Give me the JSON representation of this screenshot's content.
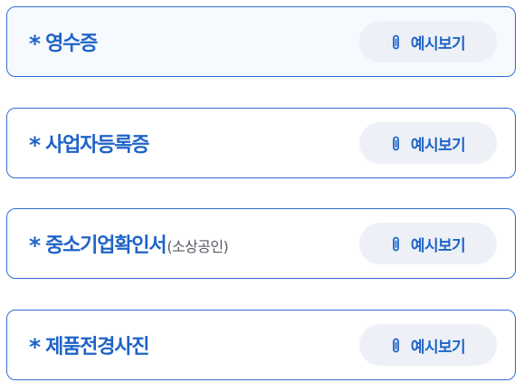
{
  "documents": [
    {
      "marker": "*",
      "title": "영수증",
      "subtitle": "",
      "button_label": "예시보기",
      "icon": "paperclip-icon"
    },
    {
      "marker": "*",
      "title": "사업자등록증",
      "subtitle": "",
      "button_label": "예시보기",
      "icon": "paperclip-icon"
    },
    {
      "marker": "*",
      "title": "중소기업확인서",
      "subtitle": "(소상공인)",
      "button_label": "예시보기",
      "icon": "paperclip-icon"
    },
    {
      "marker": "*",
      "title": "제품전경사진",
      "subtitle": "",
      "button_label": "예시보기",
      "icon": "paperclip-icon"
    }
  ],
  "colors": {
    "accent": "#1e63c7",
    "border": "#2f6fd0",
    "button_bg": "#edf1f7",
    "active_card_bg": "#f6f9fe",
    "subtitle": "#555a62"
  }
}
